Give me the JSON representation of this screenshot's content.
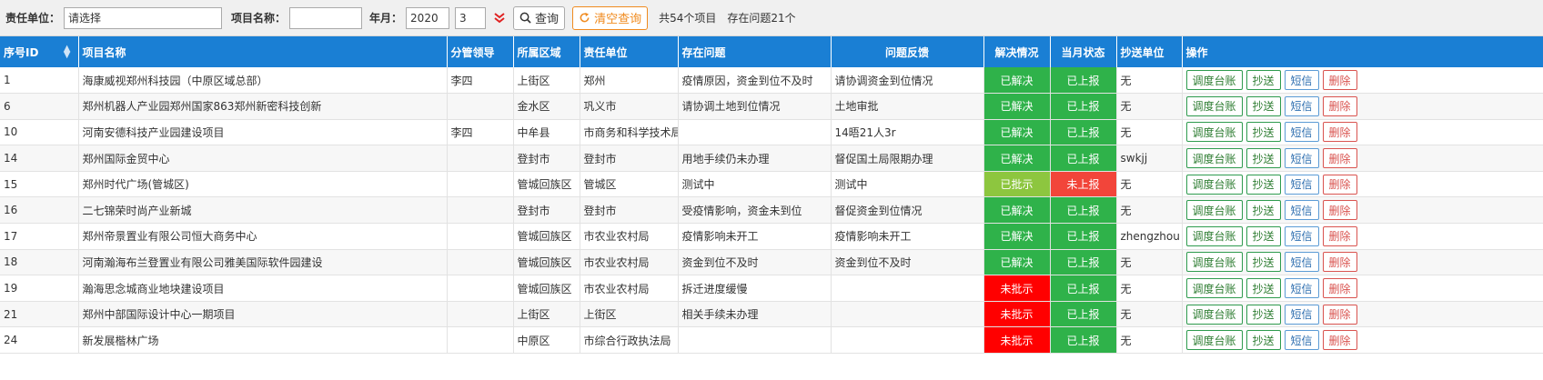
{
  "filters": {
    "unit_label": "责任单位：",
    "unit_value": "请选择",
    "project_label": "项目名称：",
    "project_value": "",
    "period_label": "年月：",
    "year": "2020",
    "month": "3",
    "search_label": "查询",
    "clear_label": "清空查询",
    "total_text": "共54个项目",
    "issues_text": "存在问题21个"
  },
  "headers": [
    "序号ID",
    "项目名称",
    "分管领导",
    "所属区域",
    "责任单位",
    "存在问题",
    "问题反馈",
    "解决情况",
    "当月状态",
    "抄送单位",
    "操作"
  ],
  "action_labels": [
    "调度台账",
    "抄送",
    "短信",
    "删除"
  ],
  "status_colors": {
    "已解决": "#2fb24a",
    "已批示": "#8dc63f",
    "未批示": "#ff0000",
    "已上报": "#2fb24a",
    "未上报": "#f2453a"
  },
  "rows": [
    {
      "id": "1",
      "name": "海康威视郑州科技园（中原区域总部）",
      "leader": "李四",
      "region": "上街区",
      "unit": "郑州",
      "issue": "疫情原因，资金到位不及时",
      "feedback": "请协调资金到位情况",
      "solve": "已解决",
      "month_status": "已上报",
      "cc": "无"
    },
    {
      "id": "6",
      "name": "郑州机器人产业园郑州国家863郑州新密科技创新",
      "leader": "",
      "region": "金水区",
      "unit": "巩义市",
      "issue": "请协调土地到位情况",
      "feedback": "土地审批",
      "solve": "已解决",
      "month_status": "已上报",
      "cc": "无"
    },
    {
      "id": "10",
      "name": "河南安德科技产业园建设项目",
      "leader": "李四",
      "region": "中牟县",
      "unit": "市商务和科学技术局",
      "issue": "",
      "feedback": "14晤21人3r",
      "solve": "已解决",
      "month_status": "已上报",
      "cc": "无"
    },
    {
      "id": "14",
      "name": "郑州国际金贸中心",
      "leader": "",
      "region": "登封市",
      "unit": "登封市",
      "issue": "用地手续仍未办理",
      "feedback": "督促国土局限期办理",
      "solve": "已解决",
      "month_status": "已上报",
      "cc": "swkjj"
    },
    {
      "id": "15",
      "name": "郑州时代广场(管城区)",
      "leader": "",
      "region": "管城回族区",
      "unit": "管城区",
      "issue": "测试中",
      "feedback": "测试中",
      "solve": "已批示",
      "month_status": "未上报",
      "cc": "无"
    },
    {
      "id": "16",
      "name": "二七锦荣时尚产业新城",
      "leader": "",
      "region": "登封市",
      "unit": "登封市",
      "issue": "受疫情影响，资金未到位",
      "feedback": "督促资金到位情况",
      "solve": "已解决",
      "month_status": "已上报",
      "cc": "无"
    },
    {
      "id": "17",
      "name": "郑州帝景置业有限公司恒大商务中心",
      "leader": "",
      "region": "管城回族区",
      "unit": "市农业农村局",
      "issue": "疫情影响未开工",
      "feedback": "疫情影响未开工",
      "solve": "已解决",
      "month_status": "已上报",
      "cc": "zhengzhou"
    },
    {
      "id": "18",
      "name": "河南瀚海布兰登置业有限公司雅美国际软件园建设",
      "leader": "",
      "region": "管城回族区",
      "unit": "市农业农村局",
      "issue": "资金到位不及时",
      "feedback": "资金到位不及时",
      "solve": "已解决",
      "month_status": "已上报",
      "cc": "无"
    },
    {
      "id": "19",
      "name": "瀚海思念城商业地块建设项目",
      "leader": "",
      "region": "管城回族区",
      "unit": "市农业农村局",
      "issue": "拆迁进度缓慢",
      "feedback": "",
      "solve": "未批示",
      "month_status": "已上报",
      "cc": "无"
    },
    {
      "id": "21",
      "name": "郑州中部国际设计中心一期项目",
      "leader": "",
      "region": "上街区",
      "unit": "上街区",
      "issue": "相关手续未办理",
      "feedback": "",
      "solve": "未批示",
      "month_status": "已上报",
      "cc": "无"
    },
    {
      "id": "24",
      "name": "新发展楷林广场",
      "leader": "",
      "region": "中原区",
      "unit": "市综合行政执法局",
      "issue": "",
      "feedback": "",
      "solve": "未批示",
      "month_status": "已上报",
      "cc": "无"
    }
  ]
}
